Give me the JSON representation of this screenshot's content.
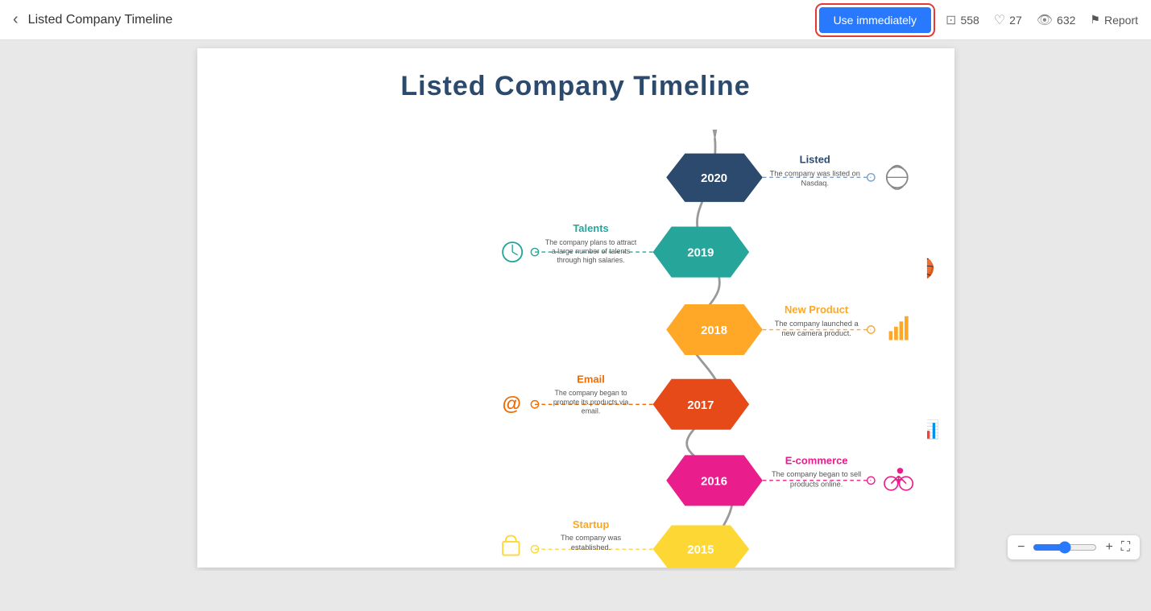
{
  "header": {
    "back_label": "‹",
    "title": "Listed Company Timeline",
    "use_immediately_label": "Use immediately",
    "stats": {
      "copies_icon": "⊡",
      "copies_count": "558",
      "likes_icon": "♡",
      "likes_count": "27",
      "views_icon": "👁",
      "views_count": "632",
      "report_icon": "⚑",
      "report_label": "Report"
    }
  },
  "slide": {
    "title": "Listed Company Timeline",
    "events": [
      {
        "year": "2020",
        "side": "right",
        "event_title": "Listed",
        "event_desc": "The company was listed on Nasdaq.",
        "color": "#2c4a6e",
        "line_color": "#7B9FC7",
        "icon": "🏀"
      },
      {
        "year": "2019",
        "side": "left",
        "event_title": "Talents",
        "event_desc": "The company plans to attract a large number of talents through high salaries.",
        "color": "#26a69a",
        "line_color": "#26a69a",
        "icon": "⏰"
      },
      {
        "year": "2018",
        "side": "right",
        "event_title": "New Product",
        "event_desc": "The company launched a new camera product.",
        "color": "#ffa726",
        "line_color": "#ffa726",
        "icon": "📊"
      },
      {
        "year": "2017",
        "side": "left",
        "event_title": "Email",
        "event_desc": "The company began to promote its products via email.",
        "color": "#ef6c00",
        "line_color": "#ef6c00",
        "icon": "@"
      },
      {
        "year": "2016",
        "side": "right",
        "event_title": "E-commerce",
        "event_desc": "The company began to sell products online.",
        "color": "#e91e8c",
        "line_color": "#e91e8c",
        "icon": "🚲"
      },
      {
        "year": "2015",
        "side": "left",
        "event_title": "Startup",
        "event_desc": "The company was established.",
        "color": "#fdd835",
        "line_color": "#fdd835",
        "icon": "🛍"
      }
    ]
  },
  "zoom": {
    "minus": "−",
    "plus": "+",
    "value": 50,
    "fullscreen_icon": "⛶"
  }
}
